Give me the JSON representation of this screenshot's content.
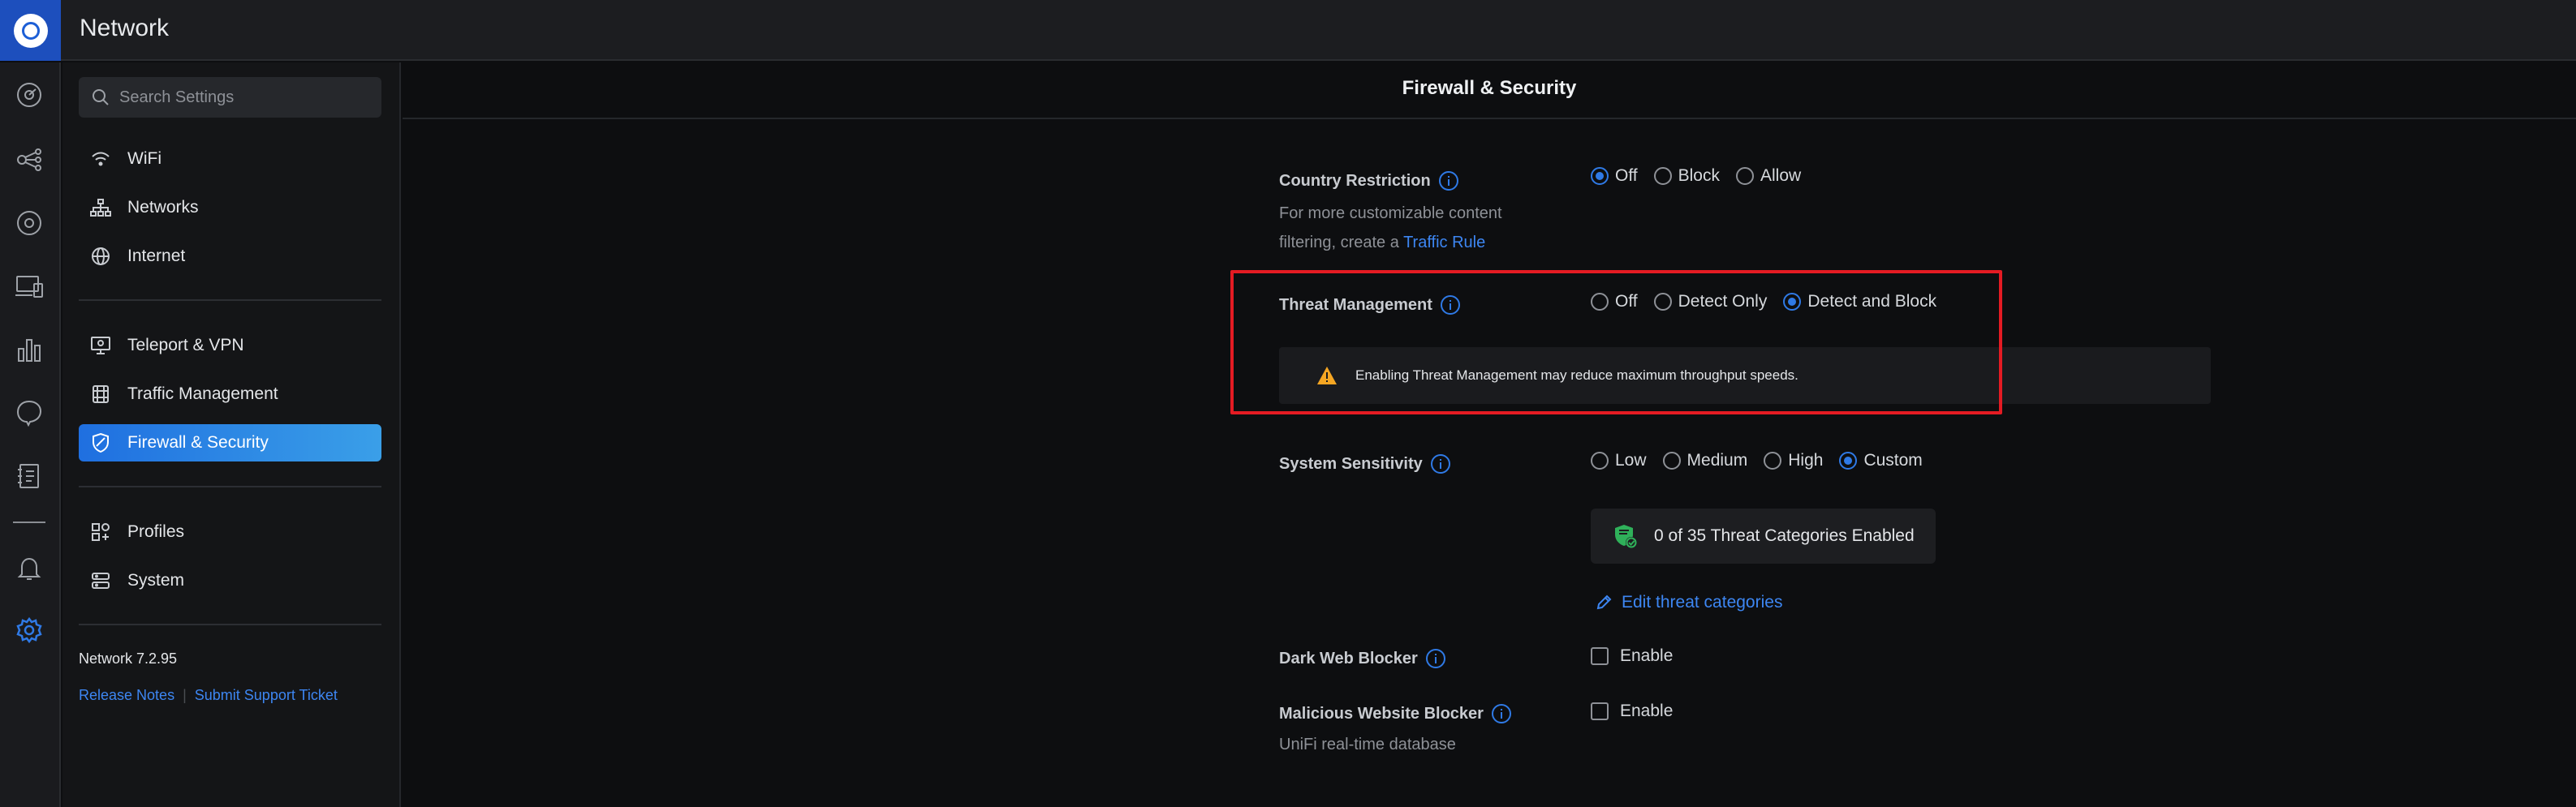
{
  "app": {
    "title": "Network"
  },
  "rail": {
    "icons": [
      "dashboard-icon",
      "topology-icon",
      "devices-icon",
      "client-devices-icon",
      "statistics-icon",
      "insights-icon",
      "logs-icon",
      "notifications-icon",
      "settings-icon"
    ]
  },
  "sidebar": {
    "search_placeholder": "Search Settings",
    "group1": [
      {
        "label": "WiFi",
        "icon": "wifi-icon"
      },
      {
        "label": "Networks",
        "icon": "networks-icon"
      },
      {
        "label": "Internet",
        "icon": "globe-icon"
      }
    ],
    "group2": [
      {
        "label": "Teleport & VPN",
        "icon": "vpn-icon"
      },
      {
        "label": "Traffic Management",
        "icon": "traffic-icon"
      },
      {
        "label": "Firewall & Security",
        "icon": "shield-icon",
        "active": true
      }
    ],
    "group3": [
      {
        "label": "Profiles",
        "icon": "profiles-icon"
      },
      {
        "label": "System",
        "icon": "system-icon"
      }
    ],
    "version": "Network 7.2.95",
    "release_notes": "Release Notes",
    "support_ticket": "Submit Support Ticket"
  },
  "page": {
    "title": "Firewall & Security",
    "country_restriction": {
      "label": "Country Restriction",
      "desc_line1": "For more customizable content",
      "desc_line2": "filtering, create a",
      "desc_link": "Traffic Rule",
      "options": [
        "Off",
        "Block",
        "Allow"
      ],
      "selected": "Off"
    },
    "threat_management": {
      "label": "Threat Management",
      "options": [
        "Off",
        "Detect Only",
        "Detect and Block"
      ],
      "selected": "Detect and Block",
      "warning": "Enabling Threat Management may reduce maximum throughput speeds."
    },
    "system_sensitivity": {
      "label": "System Sensitivity",
      "options": [
        "Low",
        "Medium",
        "High",
        "Custom"
      ],
      "selected": "Custom",
      "categories_status": "0 of 35 Threat Categories Enabled",
      "edit_link": "Edit threat categories"
    },
    "dark_web_blocker": {
      "label": "Dark Web Blocker",
      "option": "Enable",
      "checked": false
    },
    "malicious_website_blocker": {
      "label": "Malicious Website Blocker",
      "option": "Enable",
      "checked": false,
      "desc": "UniFi real-time database"
    }
  },
  "colors": {
    "accent": "#2f7ae6",
    "highlight": "#e41b23",
    "warning": "#f5a623",
    "shield_green": "#2fb15a"
  }
}
